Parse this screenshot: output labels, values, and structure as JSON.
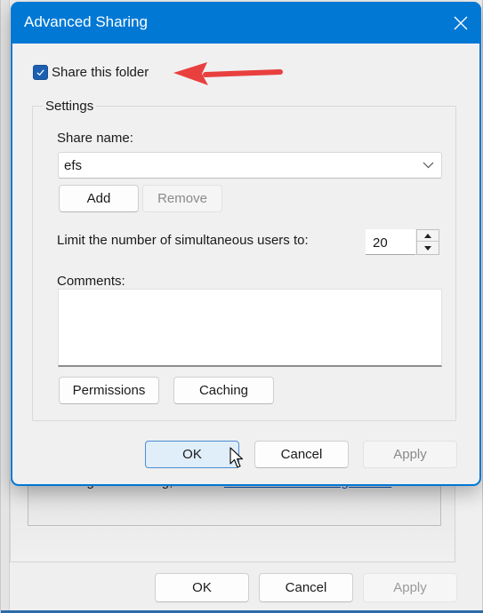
{
  "background_window": {
    "info_text_prefix": "To change this setting, use the ",
    "info_link": "Network and Sharing Center",
    "info_text_suffix": ".",
    "buttons": {
      "ok": "OK",
      "cancel": "Cancel",
      "apply": "Apply"
    }
  },
  "dialog": {
    "title": "Advanced Sharing",
    "close_icon": "close-icon",
    "share_checkbox": {
      "label": "Share this folder",
      "checked": true
    },
    "annotation": {
      "type": "arrow",
      "color": "#e8403f",
      "points_to": "Share this folder"
    },
    "settings": {
      "legend": "Settings",
      "share_name_label": "Share name:",
      "share_name_value": "efs",
      "add_label": "Add",
      "remove_label": "Remove",
      "limit_label": "Limit the number of simultaneous users to:",
      "limit_value": "20",
      "comments_label": "Comments:",
      "comments_value": "",
      "permissions_label": "Permissions",
      "caching_label": "Caching"
    },
    "buttons": {
      "ok": "OK",
      "cancel": "Cancel",
      "apply": "Apply"
    }
  },
  "colors": {
    "titlebar": "#0078d4",
    "checkbox": "#1c5fb0",
    "link": "#0b57b8",
    "arrow": "#e8403f"
  }
}
